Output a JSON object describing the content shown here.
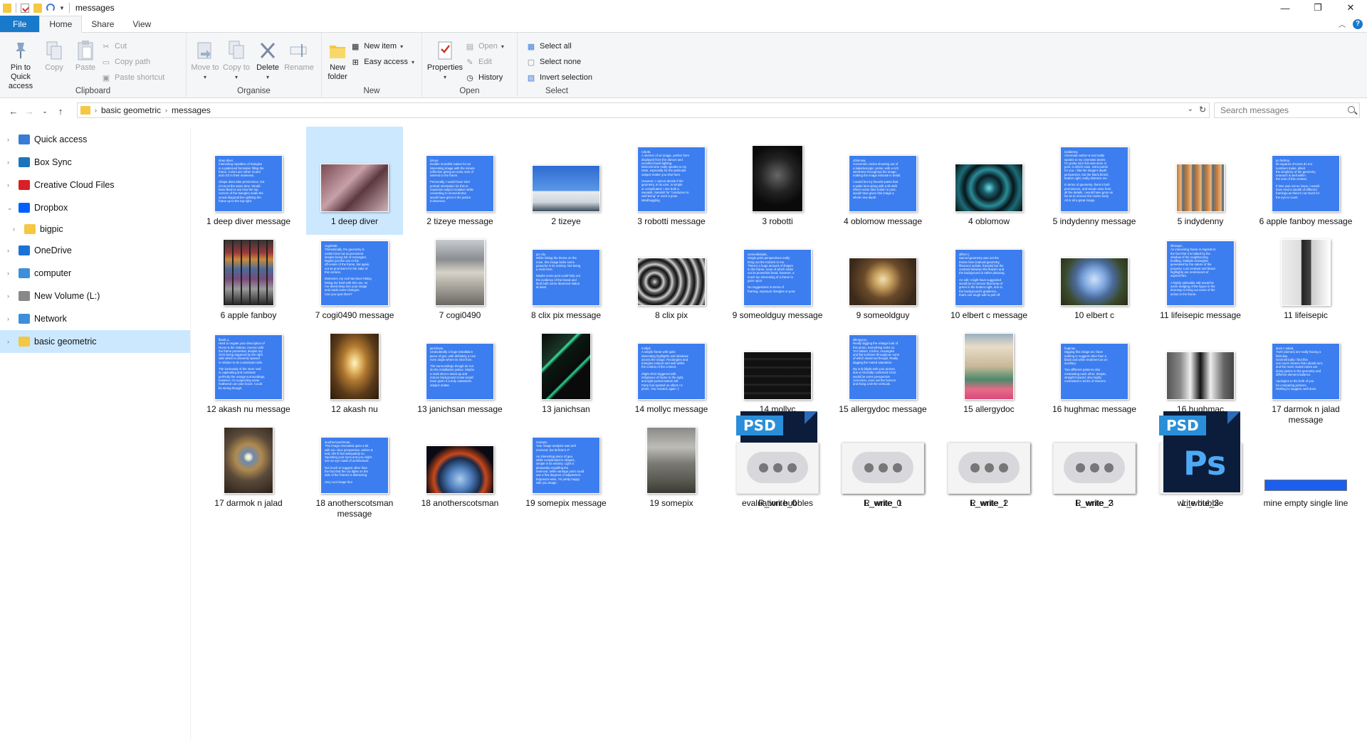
{
  "window": {
    "title": "messages",
    "minimize": "—",
    "maximize": "❐",
    "close": "✕"
  },
  "tabs": [
    "File",
    "Home",
    "Share",
    "View"
  ],
  "ribbon": {
    "clipboard": {
      "label": "Clipboard",
      "pin": "Pin to Quick access",
      "copy": "Copy",
      "paste": "Paste",
      "cut": "Cut",
      "copy_path": "Copy path",
      "paste_shortcut": "Paste shortcut"
    },
    "organise": {
      "label": "Organise",
      "move_to": "Move to",
      "copy_to": "Copy to",
      "delete": "Delete",
      "rename": "Rename"
    },
    "new": {
      "label": "New",
      "new_folder": "New folder",
      "new_item": "New item",
      "easy_access": "Easy access"
    },
    "open": {
      "label": "Open",
      "properties": "Properties",
      "open": "Open",
      "edit": "Edit",
      "history": "History"
    },
    "select": {
      "label": "Select",
      "select_all": "Select all",
      "select_none": "Select none",
      "invert": "Invert selection"
    }
  },
  "address": {
    "crumbs": [
      "basic geometric",
      "messages"
    ],
    "search_placeholder": "Search messages"
  },
  "nav": [
    {
      "label": "Quick access",
      "icon": "star-icon",
      "color": "#3a7bd5"
    },
    {
      "label": "Box Sync",
      "icon": "box-icon",
      "color": "#1b75bb"
    },
    {
      "label": "Creative Cloud Files",
      "icon": "creative-cloud-icon",
      "color": "#da1f26"
    },
    {
      "label": "Dropbox",
      "icon": "dropbox-icon",
      "color": "#0061fe"
    },
    {
      "label": "bigpic",
      "icon": "folder-icon",
      "color": "#f4c842"
    },
    {
      "label": "OneDrive",
      "icon": "cloud-icon",
      "color": "#1a73d9"
    },
    {
      "label": "computer",
      "icon": "computer-icon",
      "color": "#3d8fd9"
    },
    {
      "label": "New Volume (L:)",
      "icon": "drive-icon",
      "color": "#888888"
    },
    {
      "label": "Network",
      "icon": "network-icon",
      "color": "#3d8fd9"
    },
    {
      "label": "basic geometric",
      "icon": "folder-icon",
      "color": "#f4c842"
    }
  ],
  "files": [
    {
      "label": "1 deep diver message",
      "kind": "msg",
      "head": "deep diver,",
      "lines": [
        "Interesting repetition of triangles",
        "in a patterned formation filling the",
        "frame. Colors are rather muted",
        "and rich in their muteness.",
        "",
        "Shape does take prominence, but",
        "is lost at the same time. Would",
        "have liked to see how the top",
        "corners of the triangles made the",
        "actual diagonal line splitting the",
        "frame up to the top-right."
      ]
    },
    {
      "label": "1 deep diver",
      "kind": "photo",
      "bg": "linear-gradient(135deg,#7a4a52,#c7a0a8 40%,#5b3840 60%,#d0b2b8)",
      "w": 96,
      "h": 68
    },
    {
      "label": "2 tizeye message",
      "kind": "msg",
      "head": "tizeye,",
      "lines": [
        "Double monolith makes for an",
        "interesting image with the minute",
        "reflection giving an extra note of",
        "interest to the frame.",
        "",
        "Personally, I would have tried",
        "portrait orientation for this to",
        "maximise subject isolation while",
        "converting to monochrome",
        "would have given it the justice",
        "it deserves."
      ]
    },
    {
      "label": "2 tizeye",
      "kind": "photo",
      "bg": "linear-gradient(180deg,#2e6bd1 0%,#5b97e8 55%,#e8ecf0 56%,#cfd6dc 80%,#394a5a)",
      "w": 96,
      "h": 66
    },
    {
      "label": "3 robotti message",
      "kind": "msg",
      "head": "robotti,",
      "lines": [
        "A stunner of an image, perfect form",
        "displayed from the dancer and",
        "excellent back-lighting.",
        "Monochrome really speaks to my",
        "taste, especially for the particular",
        "subject matter you shot here.",
        "",
        "However, I cannot decide if the",
        "geometry, in its core, is simple",
        "or complicated. I see both a",
        "sweatsk, Sanskrit for \"conducive to",
        "well being\" or even a pose.",
        "Mindboggling."
      ]
    },
    {
      "label": "3 robotti",
      "kind": "photo",
      "bg": "radial-gradient(circle at 50% 45%,#666 0%,#222 40%,#0a0a0a 70%)",
      "w": 72,
      "h": 94
    },
    {
      "label": "4 oblomow message",
      "kind": "msg",
      "head": "oblomow,",
      "lines": [
        "Concentric circles shooting out of",
        "a kaleidoscopic center, with a rich",
        "wireframe throughout the image,",
        "making the image intricate in detail.",
        "",
        "I would bet my favorite pants that",
        "a wider lens along with a tilt-shift",
        "effect+some fake bokeh in post,",
        "would have given this image a",
        "whole new depth."
      ]
    },
    {
      "label": "4 oblomow",
      "kind": "photo",
      "bg": "radial-gradient(circle at 50% 50%,#6ee0e8 0%,#1a5e6a 15%,#0a1e24 30%,#2a8c98 45%,#06161a 60%,#1e6a76 75%,#050e10)",
      "w": 96,
      "h": 68
    },
    {
      "label": "5 indydenny message",
      "kind": "msg",
      "head": "indidenny,",
      "lines": [
        "Cinematic amber & teal really",
        "speaks to my cinematic tastes.",
        "I'm pretty sure this was done in",
        "post, in which case, extra points",
        "for you. I like the image's depth",
        "perspective, but the black blotch,",
        "bottom right, really distracts me.",
        "",
        "In terms of geometry, there's both",
        "prominence, and visual noise from",
        "all the details. I would have gone as",
        "far as to remove the center body.",
        "All in all a great image."
      ]
    },
    {
      "label": "5 indydenny",
      "kind": "photo",
      "bg": "repeating-linear-gradient(90deg,#c47a3c 0,#e8b680 6px,#5a6e78 8px,#c47a3c 14px)",
      "w": 68,
      "h": 68
    },
    {
      "label": "6 apple fanboy message",
      "kind": "msg",
      "head": "po fanboy,",
      "lines": [
        "50 squares of tones do not",
        "numbers make, albeit",
        "the simplicity of the geometry",
        "research is well within",
        "the vein of this contest.",
        "",
        "If time was not an issue, I would",
        "have tried a stealth of different",
        "framings as there's not much for",
        "the eye to covet."
      ]
    },
    {
      "label": "6 apple fanboy",
      "kind": "photo",
      "bg": "repeating-linear-gradient(90deg,#222 0,#222 2px,transparent 2px,transparent 12px),linear-gradient(180deg,#333 0,#9a3a3a 20%,#c98a3a 30%,#4a6a9a 45%,#7a4a7a 60%,#9a9a9a 75%,#222)",
      "w": 72,
      "h": 94
    },
    {
      "label": "7 cogi0490 message",
      "kind": "msg",
      "head": "cogi0490,",
      "lines": [
        "Thematically, the geometry is",
        "evident but not as prominent",
        "despite being full of rectangles.",
        "Maybe just the one in the",
        "off-center of the frame, but again,",
        "not as prominent for the sake of",
        "this contest.",
        "",
        "Moreover, my ocd has been hitting",
        "hitting me hard with this one, so",
        "I've dived deep into your image",
        "and made some changes.",
        "Can you spot them?"
      ]
    },
    {
      "label": "7 cogi0490",
      "kind": "photo",
      "bg": "linear-gradient(180deg,#c8ccd0 0,#8a8e90 30%,#d6d2c8 50%,#6a6862 100%)",
      "w": 70,
      "h": 94
    },
    {
      "label": "8 clix pix message",
      "kind": "msg",
      "head": "pix clix,",
      "lines": [
        "While hitting the theme on the",
        "nose, this image lacks some",
        "panache in its entirety. Not being",
        "a snob here.",
        "",
        "Maybe some post could help out",
        "the evidency of the brand and",
        "lend both some deserved status",
        "at least."
      ]
    },
    {
      "label": "8 clix pix",
      "kind": "photo",
      "bg": "repeating-radial-gradient(circle at 25% 50%,#ddd 0,#555 4px,#111 8px,#aaa 12px)",
      "w": 96,
      "h": 68
    },
    {
      "label": "9 someoldguy message",
      "kind": "msg",
      "head": "someoldduide,",
      "lines": [
        "Single point perspectives really",
        "bring out the Kubrick in me.",
        "There's a huge amount of shapes",
        "in this frame, none of which sticks",
        "out its proverbial head, however, a",
        "much too interesting of a frame to",
        "gaze upon.",
        "",
        "No suggestions in terms of",
        "framing, exposure triangles or post."
      ]
    },
    {
      "label": "9 someoldguy",
      "kind": "photo",
      "bg": "radial-gradient(circle at 50% 45%,#f0e0b0 0,#c8a060 20%,#6a4a2a 45%,#3a2a1a 80%)",
      "w": 96,
      "h": 68
    },
    {
      "label": "10 elbert c message",
      "kind": "msg",
      "head": "alfred c,",
      "lines": [
        "Sacred geometry was not the",
        "theme here (natural geometry,",
        "fibonacci spirals, fractals) but the",
        "contrast between the flowers and",
        "the background is rather pleasing.",
        "",
        "An edit I might have suggested",
        "would be to remove that lump of",
        "green in the bottom right, due to",
        "the background's gradience,",
        "that's one tough edit to pull off."
      ]
    },
    {
      "label": "10 elbert c",
      "kind": "photo",
      "bg": "radial-gradient(circle at 50% 45%,#cfe2f8 0,#7fa8e0 25%,#4a6a9a 45%,#3a4a2a 70%,#2a2a1a)",
      "w": 96,
      "h": 68
    },
    {
      "label": "11 lifeisepic message",
      "kind": "msg",
      "head": "lifeisepic,",
      "lines": [
        "An interesting frame in regards to",
        "the fact that it is halted by the",
        "shadow of the neighbouring",
        "building. Multiple rectangles",
        "generated by the nature of the",
        "property. Low contrast and blown",
        "highlights are reminiscent of",
        "expired film.",
        "",
        "A highly advisable edit would be",
        "some dodging of the figure in the",
        "doorway to bring out some of the",
        "action in the frame."
      ]
    },
    {
      "label": "11 lifeisepic",
      "kind": "photo",
      "bg": "linear-gradient(90deg,#eee 0,#ddd 40%,#222 42%,#444 60%,#ccc 62%,#fff)",
      "w": 70,
      "h": 94
    },
    {
      "label": "12 akash nu message",
      "kind": "msg",
      "head": "lbash.u,",
      "lines": [
        "Hard to negate your description of",
        "Rome & the Vatican, moreso with",
        "the frame presented, despite my",
        "OCD being triggered by the right",
        "side which is unevenly spaced",
        "in relation to its counterpart side.",
        "",
        "The luminosity of the inner oval",
        "is captivating and contrasts",
        "perfectly the orange surroundings,",
        "however, I'm suspecting some",
        "feathered out color boost. Could",
        "be wrong though."
      ]
    },
    {
      "label": "12 akash nu",
      "kind": "photo",
      "bg": "radial-gradient(ellipse at 50% 45%,#fff4c8 0,#e8c070 15%,#b07830 35%,#5a3a1a 65%,#2a1a0a)",
      "w": 70,
      "h": 94
    },
    {
      "label": "13 janichsan message",
      "kind": "msg",
      "head": "janichsan,",
      "lines": [
        "Undoubtedly a huge installation",
        "piece of geo, with definitely a nice",
        "even angle where its shot from.",
        "",
        "The surroundings though do not",
        "do the installation justice. Maybe",
        "a multi shot to stack up and",
        "reduce background noise would",
        "have given it a truly outstandin",
        "subject matter."
      ]
    },
    {
      "label": "13 janichsan",
      "kind": "photo",
      "bg": "linear-gradient(135deg,#0a0a0a 0,#1a3a2a 30%,#3ee8a0 32%,#0a1a12 36%,#0a0a0a 60%,#2ad890 62%,#0a0a0a 66%)",
      "w": 70,
      "h": 94
    },
    {
      "label": "14 mollyc message",
      "kind": "msg",
      "head": "mollyd,",
      "lines": [
        "A simple frame with quite",
        "interesting highlights and shadows",
        "across the image. Rectangles and",
        "triangles evident and well within",
        "the context of the contest.",
        "",
        "Slight OCD triggered with",
        "imbalance of frame to the right,",
        "and light pocket bottom left.",
        "Party foul spotted on elbert c's",
        "photo. You reacted, again :)"
      ]
    },
    {
      "label": "14 mollyc",
      "kind": "photo",
      "bg": "repeating-linear-gradient(180deg,#111 0,#111 8px,#2a2a2a 9px,#111 12px)",
      "w": 96,
      "h": 68
    },
    {
      "label": "15 allergydoc message",
      "kind": "msg",
      "head": "allergycoc,",
      "lines": [
        "Really digging the vintage look of",
        "this photo. Everything looks so",
        "70's Miami. Circles, rectangles",
        "and flat surfaces throughout, none",
        "of which stand out though. Really",
        "digging the muted saturation.",
        "",
        "My only blight with your picture,",
        "due to clinically confirmed OCD,",
        "would be some perspective",
        "correction, even out the horizon",
        "and fixing a bit the verticals."
      ]
    },
    {
      "label": "15 allergydoc",
      "kind": "photo",
      "bg": "linear-gradient(180deg,#9ab0c0 0,#e8dcc8 20%,#c8b898 50%,#4a8a6a 70%,#e86a8a 85%,#d84a7a)",
      "w": 70,
      "h": 94
    },
    {
      "label": "16 hughmac message",
      "kind": "msg",
      "head": "hugmac,",
      "lines": [
        "Digging this image as I have",
        "nothing to suggest other than a",
        "black and white treatment as an",
        "auxiliary.",
        "",
        "Two different patterns also",
        "contrasting each other. Simple,",
        "straight forward, also highly",
        "contrasted in terms of textures."
      ]
    },
    {
      "label": "16 hughmac",
      "kind": "photo",
      "bg": "linear-gradient(90deg,#555 0,#888 20%,#eee 35%,#111 50%,#eee 65%,#666 85%,#444)",
      "w": 96,
      "h": 68
    },
    {
      "label": "17 darmok n jalad message",
      "kind": "msg",
      "head": "duck n salad,",
      "lines": [
        "Truth (domes) are really having a",
        "field day.",
        "Geometrically I find this",
        "one much cleaner than akash.nu's,",
        "and the more muted colors are",
        "doing justice to the geometry and",
        "different element balance.",
        "",
        "Apologies to the both of you",
        "for comparing pictures.",
        "Nothing to suggest, well done."
      ]
    },
    {
      "label": "17 darmok n jalad",
      "kind": "photo",
      "bg": "radial-gradient(circle at 50% 45%,#fff 0,#e8e0c0 6%,#6a8ab0 12%,#b08a50 30%,#5a4a3a 55%,#2a2018)",
      "w": 70,
      "h": 94
    },
    {
      "label": "18 anotherscotsman message",
      "kind": "msg",
      "head": "anotherscotchman,",
      "lines": [
        "This image resonated quite a bit",
        "with me. Nice perspective, amber &",
        "teal, dim lit but adequately so.",
        "Squinting your eyes and you might",
        "see an eye made of architecture.",
        "",
        "Not much to suggest other than",
        "the fact that the cut lights on the",
        "side of the frames is distracting.",
        "",
        "Very cool image tho!"
      ]
    },
    {
      "label": "18 anotherscotsman",
      "kind": "photo",
      "bg": "radial-gradient(ellipse at 50% 70%,#aaccf0 0,#4a7ab8 25%,#1a2a48 45%,#c8481a 55%,#0a0a14 75%)",
      "w": 96,
      "h": 68
    },
    {
      "label": "19 somepix message",
      "kind": "msg",
      "head": "morepix,",
      "lines": [
        "Your image analysis was well",
        "received, but deficient :P",
        "",
        "An interesting piece of geo,",
        "while complicated in shapes,",
        "simple in its entirety. Light is",
        "pleasantly engulfing the",
        "reservoir, while vantage point could",
        "use a few degrees of adjustment.",
        "Exposure-wise, I'm pretty happy",
        "with you image."
      ]
    },
    {
      "label": "19 somepix",
      "kind": "photo",
      "bg": "linear-gradient(180deg,#8a8a88 0,#bdbcb6 30%,#7a7a74 55%,#5a5a52 80%,#3a3a34)",
      "w": 70,
      "h": 94
    },
    {
      "label": "evaluation bubbles",
      "kind": "psd"
    },
    {
      "label": "L_write_0",
      "kind": "bubble"
    },
    {
      "label": "L_write_1",
      "kind": "bubble"
    },
    {
      "label": "L_write_2",
      "kind": "bubble"
    },
    {
      "label": "L_write_3",
      "kind": "bubble"
    },
    {
      "label": "mine empty single line",
      "kind": "bar"
    },
    {
      "label": "R_write_0",
      "kind": "bubble-r"
    },
    {
      "label": "R_write_1",
      "kind": "bubble-r"
    },
    {
      "label": "R_write_2",
      "kind": "bubble-r"
    },
    {
      "label": "R_write_3",
      "kind": "bubble-r"
    },
    {
      "label": "write bubble",
      "kind": "psd"
    }
  ],
  "psd_tag": "PSD",
  "psd_ps": "Ps",
  "selected_file": "1 deep diver"
}
